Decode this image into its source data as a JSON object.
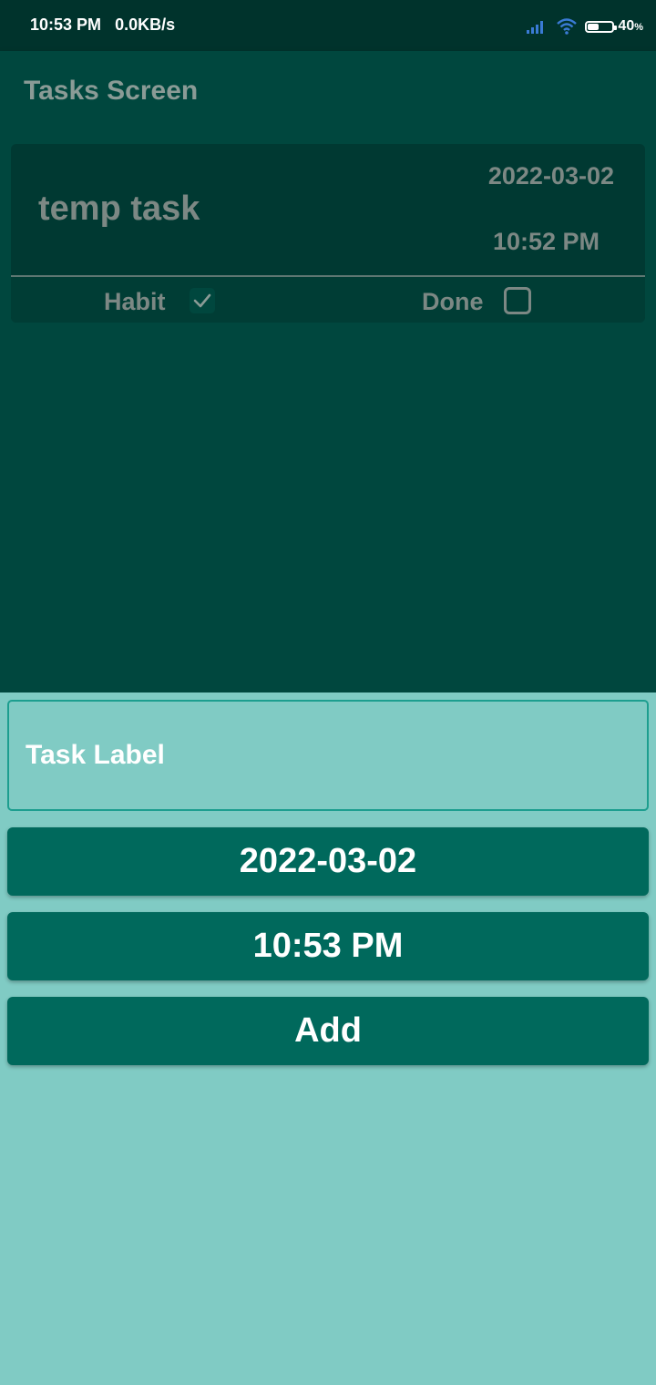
{
  "status_bar": {
    "time": "10:53 PM",
    "network_speed": "0.0KB/s",
    "battery_percent": "40",
    "battery_percent_sign": "%",
    "icons": [
      "signal-icon",
      "wifi-icon",
      "battery-icon"
    ]
  },
  "app_bar": {
    "title": "Tasks Screen"
  },
  "tasks": [
    {
      "name": "temp task",
      "date": "2022-03-02",
      "time": "10:52 PM",
      "habit_label": "Habit",
      "habit_checked": true,
      "done_label": "Done",
      "done_checked": false
    }
  ],
  "form": {
    "task_label_placeholder": "Task Label",
    "task_label_value": "",
    "date_button": "2022-03-02",
    "time_button": "10:53 PM",
    "add_button": "Add"
  },
  "colors": {
    "status_bar": "#00332c",
    "app_bar": "#00473e",
    "card": "#003932",
    "form_background": "#80cbc4",
    "button": "#00695c",
    "muted_text": "#7c8884"
  }
}
